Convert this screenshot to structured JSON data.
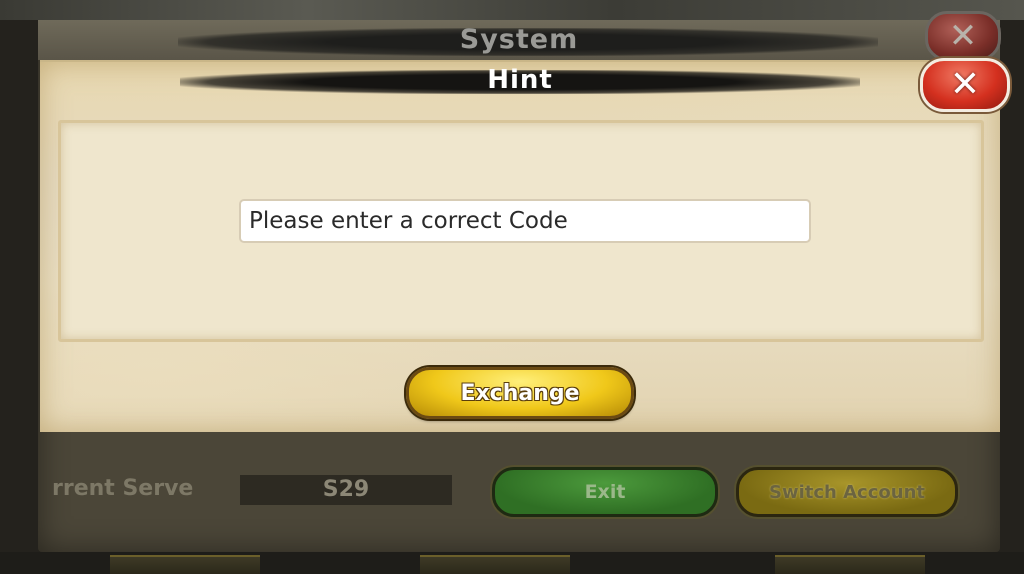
{
  "system_panel": {
    "title": "System",
    "close_glyph": "✕",
    "server_label": "rrent Serve",
    "server_value": "S29",
    "exit_label": "Exit",
    "switch_account_label": "Switch Account"
  },
  "hint_dialog": {
    "title": "Hint",
    "close_glyph": "✕",
    "code_input_value": "Please enter a correct Code",
    "exchange_label": "Exchange"
  },
  "colors": {
    "parchment": "#e9dfc6",
    "exchange_gold": "#f0c81a",
    "close_red": "#d4301f",
    "exit_green": "#2f6f24"
  }
}
